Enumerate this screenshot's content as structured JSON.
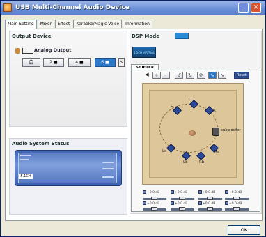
{
  "window": {
    "title": "USB Multi-Channel Audio Device"
  },
  "tabs": [
    "Main Setting",
    "Mixer",
    "Effect",
    "Karaoke/Magic Voice",
    "Information"
  ],
  "output": {
    "title": "Output Device",
    "analog_label": "Analog Output",
    "buttons": [
      "",
      "2",
      "4",
      "6"
    ],
    "selected_index": 3
  },
  "status": {
    "title": "Audio System Status",
    "display_label": "5.1CH"
  },
  "dsp": {
    "mode_label": "DSP Mode",
    "display": "5.1CH VIRTUAL"
  },
  "shifter": {
    "tab_label": "SHIFTER",
    "reset_label": "Reset",
    "speakers": [
      "L",
      "C",
      "R",
      "Ls",
      "Rs",
      "Lb",
      "Rb"
    ],
    "subwoofer_label": "subwoofer",
    "levels": [
      "+0.0 dB",
      "+0.0 dB",
      "+0.0 dB",
      "+0.0 dB",
      "+0.0 dB",
      "+0.0 dB",
      "+0.0 dB",
      "+0.0 dB"
    ]
  },
  "footer": {
    "ok_label": "OK"
  },
  "colors": {
    "title_bar": "#6a8fd8",
    "accent": "#2e78c8",
    "room": "#e2cfa3",
    "speaker": "#2c4a98"
  }
}
